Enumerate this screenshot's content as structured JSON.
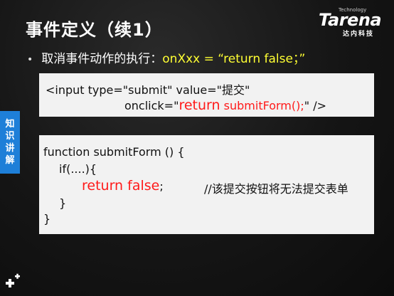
{
  "slide": {
    "title": "事件定义（续1）",
    "logo": {
      "small": "Technology",
      "main": "Tarena",
      "sub": "达内科技"
    },
    "bullet": {
      "prefix": "取消事件动作的执行：",
      "code": "onXxx =  “return false；”"
    },
    "box1": {
      "line1": "<input type=\"submit\"  value=\"提交\"",
      "line2_a": "onclick=\"",
      "line2_red1": "return",
      "line2_red2": " submitForm();",
      "line2_b": "\" />"
    },
    "box2": {
      "line1": "function submitForm () {",
      "line2": "if(....){",
      "line3_red": "return false",
      "line3_semi": ";",
      "line3_comment": "//该提交按钮将无法提交表单",
      "line4": "}",
      "line5": "}"
    },
    "side_tab": [
      "知",
      "识",
      "讲",
      "解"
    ],
    "colors": {
      "highlight": "#ffff33",
      "code_red": "#ff1a1a",
      "tab_blue": "#1e7fd8"
    }
  }
}
